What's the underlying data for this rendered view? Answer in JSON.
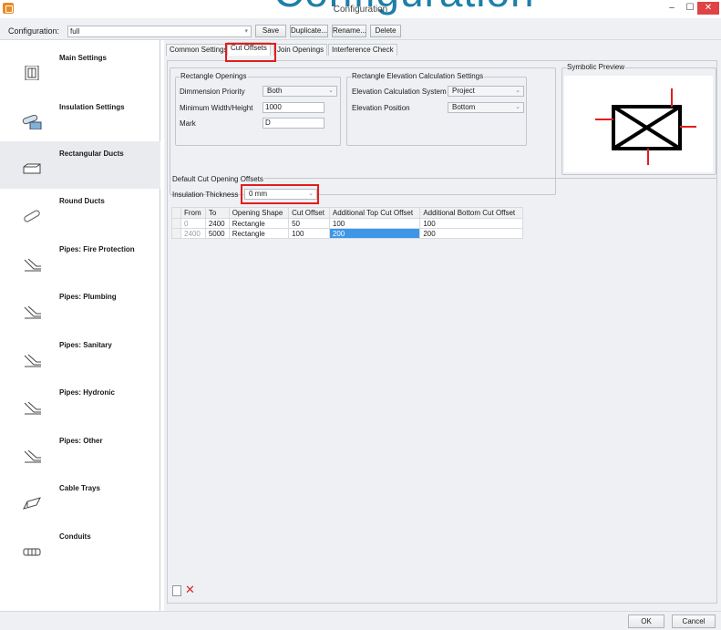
{
  "window": {
    "title": "Configuration",
    "overlay_text": "Configuration",
    "minimize_glyph": "‒",
    "maximize_glyph": "☐",
    "close_glyph": "✕",
    "close_color": "#e04343",
    "accent_color": "#e21d1d"
  },
  "configbar": {
    "label": "Configuration:",
    "selected": "full",
    "buttons": {
      "save": "Save",
      "duplicate": "Duplicate...",
      "rename": "Rename...",
      "delete": "Delete"
    }
  },
  "sidebar": {
    "items": [
      {
        "label": "Main Settings",
        "icon": "main-settings-icon"
      },
      {
        "label": "Insulation Settings",
        "icon": "insulation-icon"
      },
      {
        "label": "Rectangular Ducts",
        "icon": "rectangular-duct-icon",
        "selected": true
      },
      {
        "label": "Round Ducts",
        "icon": "round-duct-icon"
      },
      {
        "label": "Pipes: Fire Protection",
        "icon": "pipe-icon"
      },
      {
        "label": "Pipes: Plumbing",
        "icon": "pipe-icon"
      },
      {
        "label": "Pipes: Sanitary",
        "icon": "pipe-icon"
      },
      {
        "label": "Pipes: Hydronic",
        "icon": "pipe-icon"
      },
      {
        "label": "Pipes: Other",
        "icon": "pipe-icon"
      },
      {
        "label": "Cable Trays",
        "icon": "cable-tray-icon"
      },
      {
        "label": "Conduits",
        "icon": "conduit-icon"
      }
    ]
  },
  "tabs": [
    {
      "label": "Common Settings"
    },
    {
      "label": "Cut Offsets",
      "active": true
    },
    {
      "label": "Join Openings"
    },
    {
      "label": "Interference Check"
    }
  ],
  "rect_openings": {
    "legend": "Rectangle Openings",
    "dim_priority_label": "Dimmension Priority",
    "dim_priority_value": "Both",
    "min_size_label": "Minimum Width/Height",
    "min_size_value": "1000",
    "mark_label": "Mark",
    "mark_value": "D"
  },
  "elevation": {
    "legend": "Rectangle Elevation Calculation Settings",
    "system_label": "Elevation Calculation System",
    "system_value": "Project",
    "position_label": "Elevation Position",
    "position_value": "Bottom"
  },
  "preview": {
    "legend": "Symbolic Preview"
  },
  "cut_offsets": {
    "legend": "Default Cut Opening Offsets",
    "insulation_label": "Insulation Thickness",
    "insulation_value": "0 mm",
    "columns": [
      "From",
      "To",
      "Opening Shape",
      "Cut Offset",
      "Additional Top Cut Offset",
      "Additional Bottom Cut Offset"
    ],
    "rows": [
      [
        "0",
        "2400",
        "Rectangle",
        "50",
        "100",
        "100"
      ],
      [
        "2400",
        "5000",
        "Rectangle",
        "100",
        "200",
        "200"
      ]
    ]
  },
  "footer": {
    "ok": "OK",
    "cancel": "Cancel"
  }
}
